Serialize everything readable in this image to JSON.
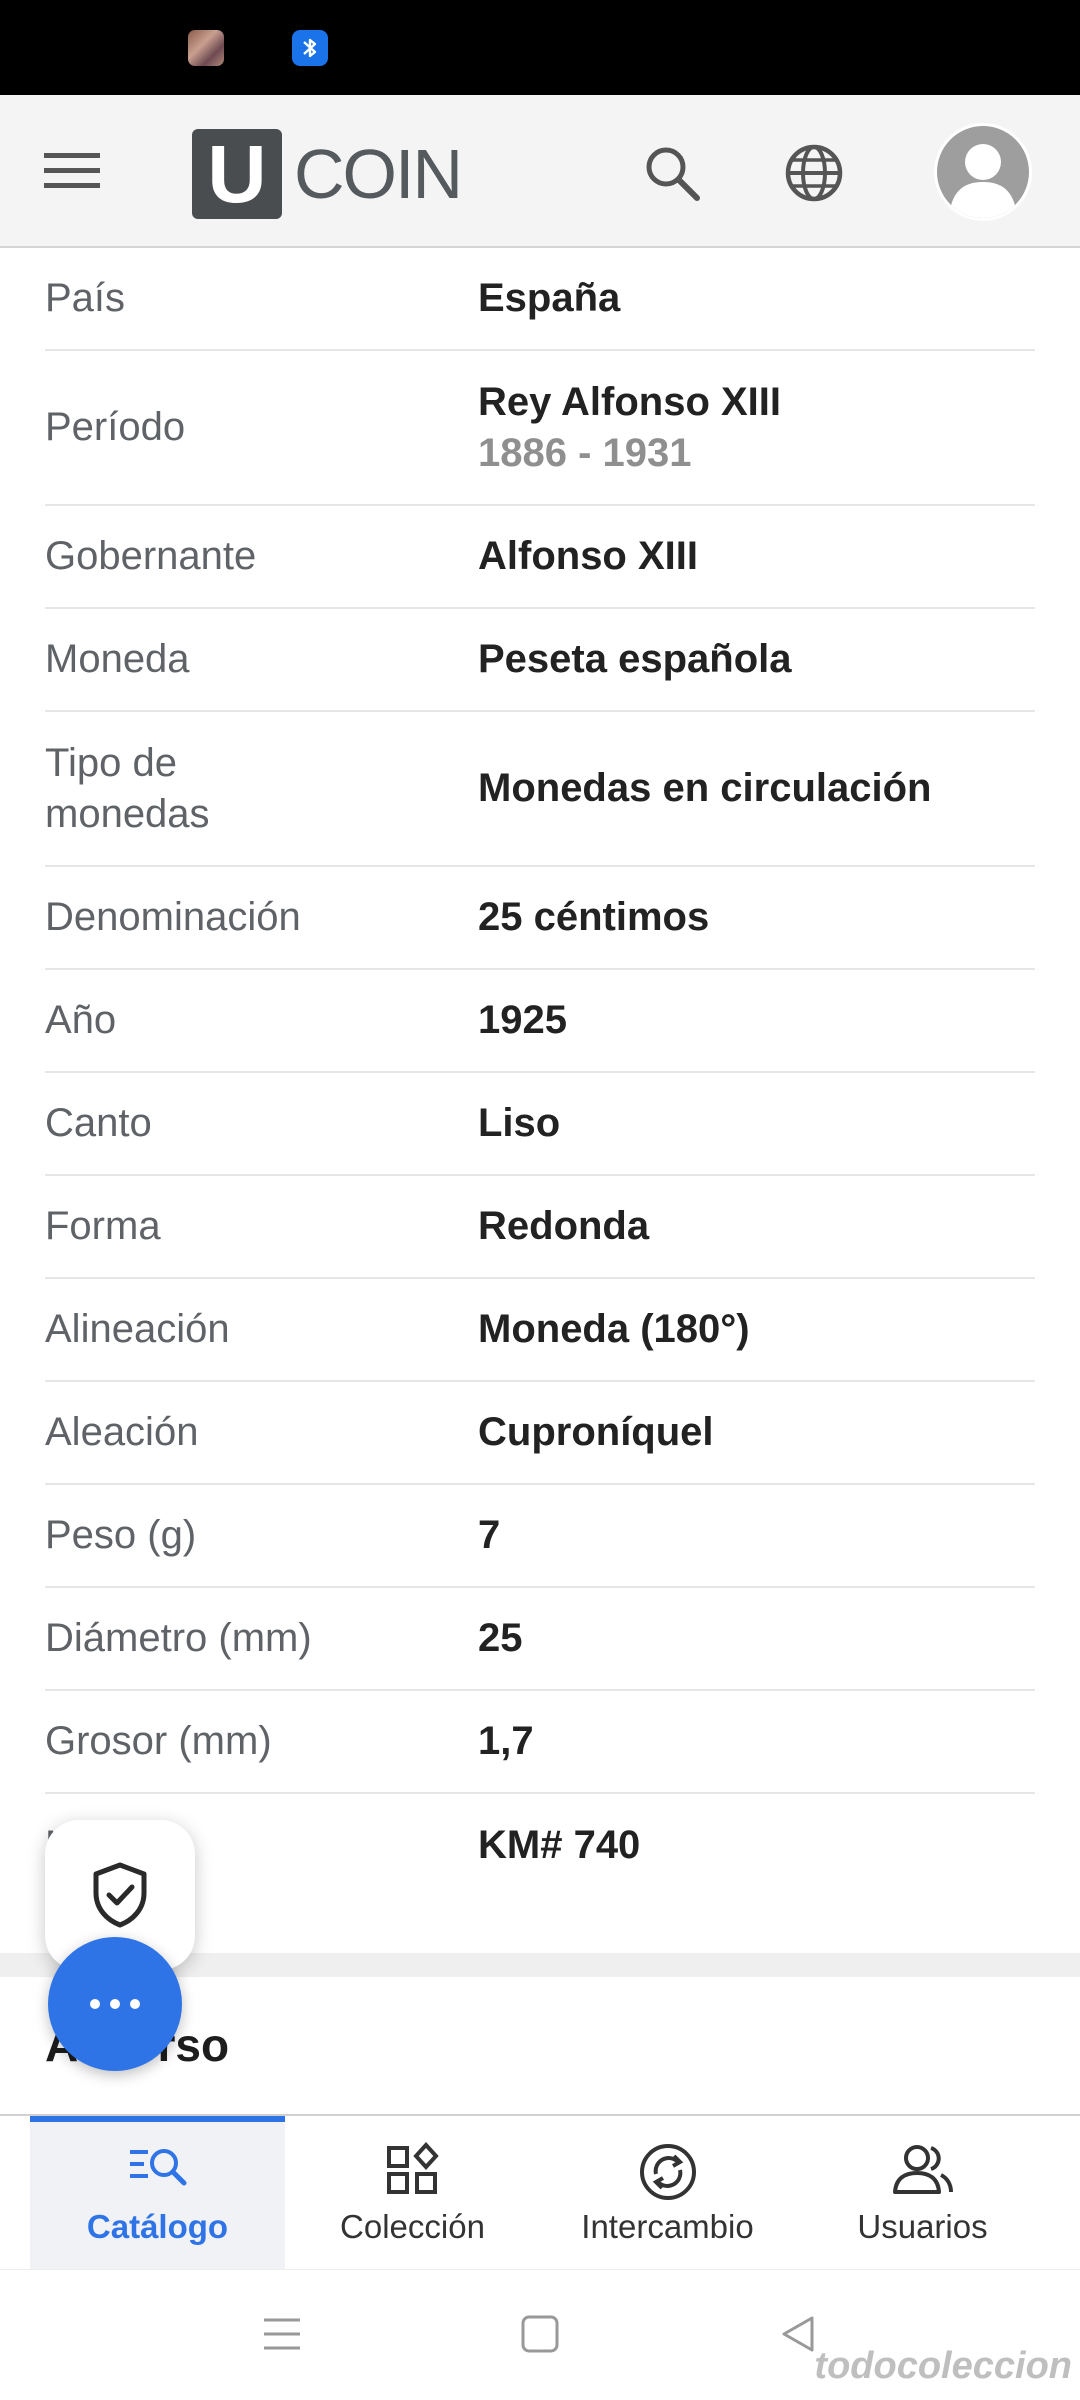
{
  "status_bar": {
    "icons": [
      "notification-thumbnail-icon",
      "bluetooth-icon"
    ]
  },
  "header": {
    "logo_letter": "U",
    "logo_text": "COIN",
    "icons": [
      "menu-icon",
      "search-icon",
      "globe-icon",
      "avatar"
    ]
  },
  "details": [
    {
      "label": "País",
      "value": "España"
    },
    {
      "label": "Período",
      "value": "Rey Alfonso XIII",
      "sub": "1886 - 1931"
    },
    {
      "label": "Gobernante",
      "value": "Alfonso XIII"
    },
    {
      "label": "Moneda",
      "value": "Peseta española"
    },
    {
      "label": "Tipo de monedas",
      "value": "Monedas en circulación"
    },
    {
      "label": "Denominación",
      "value": "25 céntimos"
    },
    {
      "label": "Año",
      "value": "1925"
    },
    {
      "label": "Canto",
      "value": "Liso"
    },
    {
      "label": "Forma",
      "value": "Redonda"
    },
    {
      "label": "Alineación",
      "value": "Moneda (180°)"
    },
    {
      "label": "Aleación",
      "value": "Cuproníquel"
    },
    {
      "label": "Peso (g)",
      "value": "7"
    },
    {
      "label": "Diámetro (mm)",
      "value": "25"
    },
    {
      "label": "Grosor (mm)",
      "value": "1,7"
    },
    {
      "label": "Número",
      "value": "KM# 740"
    }
  ],
  "section": {
    "title": "Anverso"
  },
  "bottom_nav": [
    {
      "label": "Catálogo",
      "icon": "catalog-search-icon",
      "active": true
    },
    {
      "label": "Colección",
      "icon": "collection-icon",
      "active": false
    },
    {
      "label": "Intercambio",
      "icon": "exchange-icon",
      "active": false
    },
    {
      "label": "Usuarios",
      "icon": "users-icon",
      "active": false
    }
  ],
  "watermark": "todocoleccion",
  "colors": {
    "accent": "#2f74e6",
    "header_bg": "#f4f4f5",
    "label": "#5f6368",
    "value": "#222222",
    "sub_value": "#8f8f8f"
  }
}
